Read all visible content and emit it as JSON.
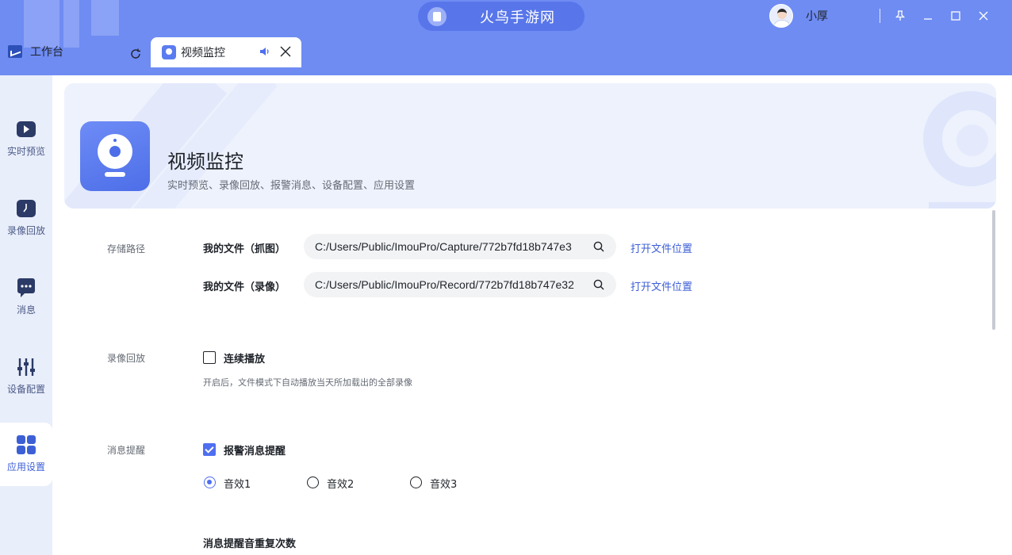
{
  "colors": {
    "accent": "#4f6ef0",
    "titlebar": "#6f8cf3",
    "link": "#3d5fd6"
  },
  "titlebar": {
    "app_title": "火鸟手游网",
    "user_name": "小厚",
    "icons": [
      "pin-icon",
      "minimize-icon",
      "maximize-icon",
      "close-icon"
    ]
  },
  "tabs": {
    "workbench": "工作台",
    "video": "视频监控"
  },
  "nav": {
    "items": [
      {
        "label": "实时预览",
        "icon": "play-icon"
      },
      {
        "label": "录像回放",
        "icon": "clock-icon"
      },
      {
        "label": "消息",
        "icon": "message-icon"
      },
      {
        "label": "设备配置",
        "icon": "sliders-icon"
      },
      {
        "label": "应用设置",
        "icon": "grid-icon"
      }
    ],
    "active_index": 4
  },
  "hero": {
    "title": "视频监控",
    "subtitle": "实时预览、录像回放、报警消息、设备配置、应用设置"
  },
  "storage": {
    "section": "存储路径",
    "capture_label": "我的文件（抓图）",
    "capture_path": "C:/Users/Public/ImouPro/Capture/772b7fd18b747e3",
    "record_label": "我的文件（录像）",
    "record_path": "C:/Users/Public/ImouPro/Record/772b7fd18b747e32",
    "open_link": "打开文件位置"
  },
  "playback": {
    "section": "录像回放",
    "continuous_label": "连续播放",
    "continuous_checked": false,
    "hint": "开启后，文件模式下自动播放当天所加载出的全部录像"
  },
  "alerts": {
    "section": "消息提醒",
    "alarm_label": "报警消息提醒",
    "alarm_checked": true,
    "sounds": [
      "音效1",
      "音效2",
      "音效3"
    ],
    "selected_sound": "音效1",
    "repeat_label": "消息提醒音重复次数"
  }
}
